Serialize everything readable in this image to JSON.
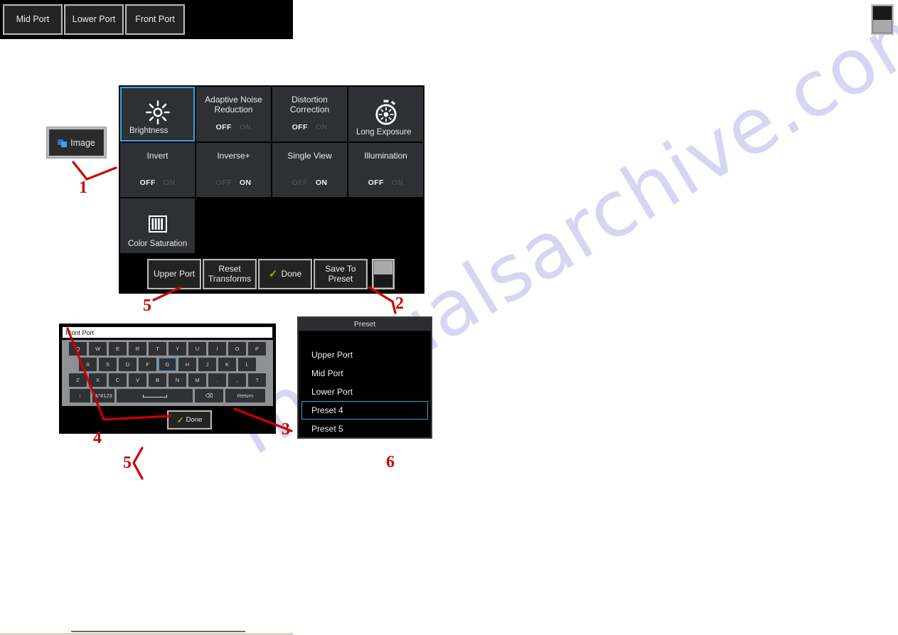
{
  "watermark": {
    "text": "manualsarchive.com"
  },
  "image_button": {
    "label": "Image",
    "icon": "image-icon"
  },
  "settings_panel": {
    "tiles": [
      {
        "title": "Brightness",
        "icon": "brightness-sun-icon",
        "title_pos": "bottom",
        "selected": true,
        "toggle": null
      },
      {
        "title": "Adaptive Noise Reduction",
        "icon": null,
        "title_pos": "top",
        "selected": false,
        "toggle": {
          "off": "OFF",
          "on": "ON",
          "active": "off"
        }
      },
      {
        "title": "Distortion Correction",
        "icon": null,
        "title_pos": "top",
        "selected": false,
        "toggle": {
          "off": "OFF",
          "on": "ON",
          "active": "off"
        }
      },
      {
        "title": "Long Exposure",
        "icon": "stopwatch-exposure-icon",
        "title_pos": "bottom",
        "selected": false,
        "toggle": null
      },
      {
        "title": "Invert",
        "icon": null,
        "title_pos": "top",
        "selected": false,
        "toggle": {
          "off": "OFF",
          "on": "ON",
          "active": "off"
        }
      },
      {
        "title": "Inverse+",
        "icon": null,
        "title_pos": "top",
        "selected": false,
        "toggle": {
          "off": "OFF",
          "on": "ON",
          "active": "on"
        }
      },
      {
        "title": "Single View",
        "icon": null,
        "title_pos": "top",
        "selected": false,
        "toggle": {
          "off": "OFF",
          "on": "ON",
          "active": "on"
        }
      },
      {
        "title": "Illumination",
        "icon": null,
        "title_pos": "top",
        "selected": false,
        "toggle": {
          "off": "OFF",
          "on": "ON",
          "active": "off"
        }
      },
      {
        "title": "Color Saturation",
        "icon": "color-bars-icon",
        "title_pos": "bottom",
        "selected": false,
        "toggle": null
      }
    ],
    "toolbar": {
      "upper_port": "Upper Port",
      "reset_transforms": "Reset\nTransforms",
      "reset_transforms_line1": "Reset",
      "reset_transforms_line2": "Transforms",
      "done": "Done",
      "save_to_preset_line1": "Save To",
      "save_to_preset_line2": "Preset",
      "scroll_indicator": "scroll-indicator"
    }
  },
  "keyboard_panel": {
    "textfield_value": "Front Port",
    "rows": [
      [
        "Q",
        "W",
        "E",
        "R",
        "T",
        "Y",
        "U",
        "I",
        "O",
        "P"
      ],
      [
        "A",
        "S",
        "D",
        "F",
        "G",
        "H",
        "J",
        "K",
        "L"
      ],
      [
        "Z",
        "X",
        "C",
        "V",
        "B",
        "N",
        "M",
        ".",
        ",",
        "?"
      ]
    ],
    "selected_key": "G",
    "bottom_row": {
      "shift": "↑",
      "symbols": "&*#123",
      "space": "",
      "backspace": "⌫",
      "return": "Return"
    },
    "done_label": "Done"
  },
  "preset_panel": {
    "header": "Preset",
    "items": [
      "Upper Port",
      "Mid Port",
      "Lower Port",
      "Preset 4",
      "Preset 5"
    ],
    "selected": "Preset 4"
  },
  "port_toolbar": {
    "buttons": [
      "Mid Port",
      "Lower Port",
      "Front Port"
    ],
    "scroll_indicator": "scroll-indicator"
  },
  "callouts": {
    "one": "1",
    "two": "2",
    "three": "3",
    "four": "4",
    "five_a": "5",
    "five_b": "5",
    "six": "6",
    "color": "#cc0000"
  }
}
